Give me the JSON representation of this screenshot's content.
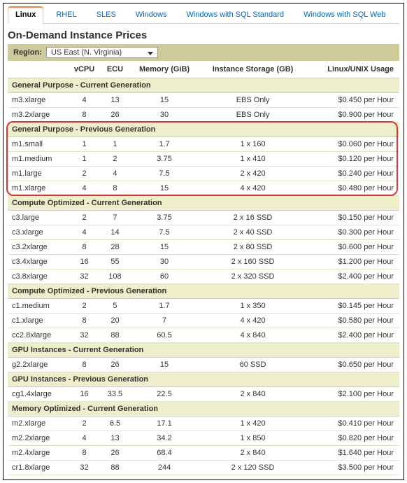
{
  "tabs": [
    "Linux",
    "RHEL",
    "SLES",
    "Windows",
    "Windows with SQL Standard",
    "Windows with SQL Web"
  ],
  "active_tab": 0,
  "title": "On-Demand Instance Prices",
  "region_label": "Region:",
  "region_value": "US East (N. Virginia)",
  "columns": [
    "",
    "vCPU",
    "ECU",
    "Memory (GiB)",
    "Instance Storage (GB)",
    "Linux/UNIX Usage"
  ],
  "sections": [
    {
      "title": "General Purpose - Current Generation",
      "highlight": false,
      "rows": [
        {
          "name": "m3.xlarge",
          "vcpu": "4",
          "ecu": "13",
          "mem": "15",
          "storage": "EBS Only",
          "usage": "$0.450 per Hour"
        },
        {
          "name": "m3.2xlarge",
          "vcpu": "8",
          "ecu": "26",
          "mem": "30",
          "storage": "EBS Only",
          "usage": "$0.900 per Hour"
        }
      ]
    },
    {
      "title": "General Purpose - Previous Generation",
      "highlight": true,
      "rows": [
        {
          "name": "m1.small",
          "vcpu": "1",
          "ecu": "1",
          "mem": "1.7",
          "storage": "1 x 160",
          "usage": "$0.060 per Hour"
        },
        {
          "name": "m1.medium",
          "vcpu": "1",
          "ecu": "2",
          "mem": "3.75",
          "storage": "1 x 410",
          "usage": "$0.120 per Hour"
        },
        {
          "name": "m1.large",
          "vcpu": "2",
          "ecu": "4",
          "mem": "7.5",
          "storage": "2 x 420",
          "usage": "$0.240 per Hour"
        },
        {
          "name": "m1.xlarge",
          "vcpu": "4",
          "ecu": "8",
          "mem": "15",
          "storage": "4 x 420",
          "usage": "$0.480 per Hour"
        }
      ]
    },
    {
      "title": "Compute Optimized - Current Generation",
      "highlight": false,
      "rows": [
        {
          "name": "c3.large",
          "vcpu": "2",
          "ecu": "7",
          "mem": "3.75",
          "storage": "2 x 16 SSD",
          "usage": "$0.150 per Hour"
        },
        {
          "name": "c3.xlarge",
          "vcpu": "4",
          "ecu": "14",
          "mem": "7.5",
          "storage": "2 x 40 SSD",
          "usage": "$0.300 per Hour"
        },
        {
          "name": "c3.2xlarge",
          "vcpu": "8",
          "ecu": "28",
          "mem": "15",
          "storage": "2 x 80 SSD",
          "usage": "$0.600 per Hour"
        },
        {
          "name": "c3.4xlarge",
          "vcpu": "16",
          "ecu": "55",
          "mem": "30",
          "storage": "2 x 160 SSD",
          "usage": "$1.200 per Hour"
        },
        {
          "name": "c3.8xlarge",
          "vcpu": "32",
          "ecu": "108",
          "mem": "60",
          "storage": "2 x 320 SSD",
          "usage": "$2.400 per Hour"
        }
      ]
    },
    {
      "title": "Compute Optimized - Previous Generation",
      "highlight": false,
      "rows": [
        {
          "name": "c1.medium",
          "vcpu": "2",
          "ecu": "5",
          "mem": "1.7",
          "storage": "1 x 350",
          "usage": "$0.145 per Hour"
        },
        {
          "name": "c1.xlarge",
          "vcpu": "8",
          "ecu": "20",
          "mem": "7",
          "storage": "4 x 420",
          "usage": "$0.580 per Hour"
        },
        {
          "name": "cc2.8xlarge",
          "vcpu": "32",
          "ecu": "88",
          "mem": "60.5",
          "storage": "4 x 840",
          "usage": "$2.400 per Hour"
        }
      ]
    },
    {
      "title": "GPU Instances - Current Generation",
      "highlight": false,
      "rows": [
        {
          "name": "g2.2xlarge",
          "vcpu": "8",
          "ecu": "26",
          "mem": "15",
          "storage": "60 SSD",
          "usage": "$0.650 per Hour"
        }
      ]
    },
    {
      "title": "GPU Instances - Previous Generation",
      "highlight": false,
      "rows": [
        {
          "name": "cg1.4xlarge",
          "vcpu": "16",
          "ecu": "33.5",
          "mem": "22.5",
          "storage": "2 x 840",
          "usage": "$2.100 per Hour"
        }
      ]
    },
    {
      "title": "Memory Optimized - Current Generation",
      "highlight": false,
      "rows": [
        {
          "name": "m2.xlarge",
          "vcpu": "2",
          "ecu": "6.5",
          "mem": "17.1",
          "storage": "1 x 420",
          "usage": "$0.410 per Hour"
        },
        {
          "name": "m2.2xlarge",
          "vcpu": "4",
          "ecu": "13",
          "mem": "34.2",
          "storage": "1 x 850",
          "usage": "$0.820 per Hour"
        },
        {
          "name": "m2.4xlarge",
          "vcpu": "8",
          "ecu": "26",
          "mem": "68.4",
          "storage": "2 x 840",
          "usage": "$1.640 per Hour"
        },
        {
          "name": "cr1.8xlarge",
          "vcpu": "32",
          "ecu": "88",
          "mem": "244",
          "storage": "2 x 120 SSD",
          "usage": "$3.500 per Hour"
        }
      ]
    }
  ]
}
